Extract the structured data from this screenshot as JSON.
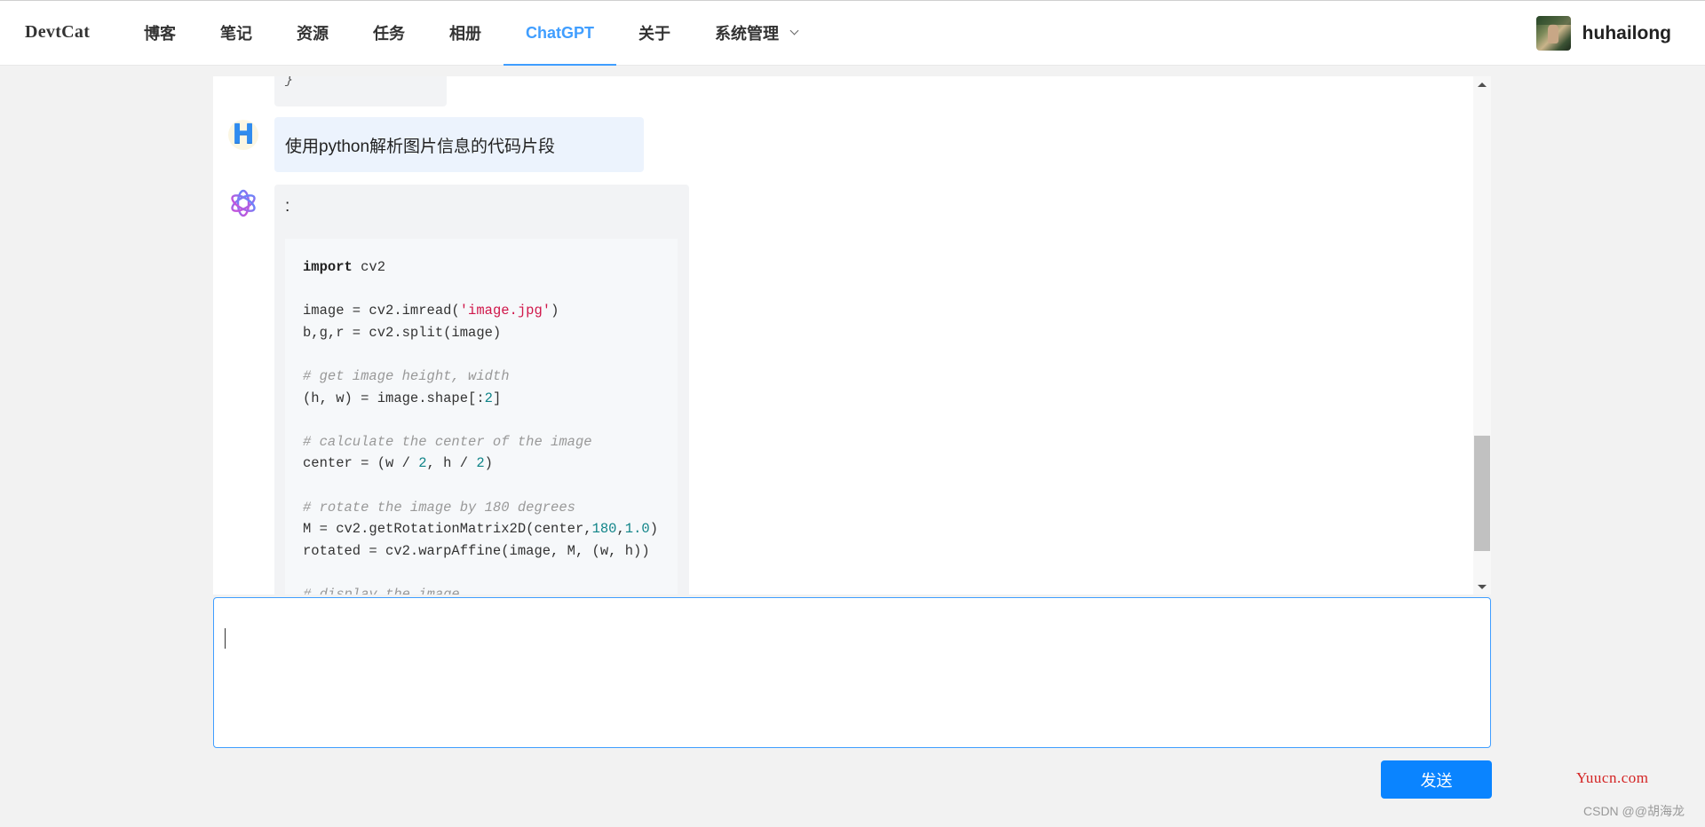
{
  "header": {
    "brand": "DevtCat",
    "nav": [
      {
        "label": "博客",
        "active": false
      },
      {
        "label": "笔记",
        "active": false
      },
      {
        "label": "资源",
        "active": false
      },
      {
        "label": "任务",
        "active": false
      },
      {
        "label": "相册",
        "active": false
      },
      {
        "label": "ChatGPT",
        "active": true
      },
      {
        "label": "关于",
        "active": false
      },
      {
        "label": "系统管理",
        "active": false,
        "dropdown": true
      }
    ],
    "user": {
      "name": "huhailong"
    }
  },
  "chat": {
    "previous_tail": "}",
    "user_avatar_letter": "H",
    "user_message": "使用python解析图片信息的代码片段",
    "bot_intro": ":",
    "code_lines": [
      [
        {
          "t": "import",
          "c": "kw"
        },
        {
          "t": " cv2",
          "c": ""
        }
      ],
      [],
      [
        {
          "t": "image = cv2.imread(",
          "c": ""
        },
        {
          "t": "'image.jpg'",
          "c": "str"
        },
        {
          "t": ")",
          "c": ""
        }
      ],
      [
        {
          "t": "b,g,r = cv2.split(image)",
          "c": ""
        }
      ],
      [],
      [
        {
          "t": "# get image height, width",
          "c": "cmt"
        }
      ],
      [
        {
          "t": "(h, w) = image.shape[:",
          "c": ""
        },
        {
          "t": "2",
          "c": "num"
        },
        {
          "t": "]",
          "c": ""
        }
      ],
      [],
      [
        {
          "t": "# calculate the center of the image",
          "c": "cmt"
        }
      ],
      [
        {
          "t": "center = (w / ",
          "c": ""
        },
        {
          "t": "2",
          "c": "num"
        },
        {
          "t": ", h / ",
          "c": ""
        },
        {
          "t": "2",
          "c": "num"
        },
        {
          "t": ")",
          "c": ""
        }
      ],
      [],
      [
        {
          "t": "# rotate the image by 180 degrees",
          "c": "cmt"
        }
      ],
      [
        {
          "t": "M = cv2.getRotationMatrix2D(center,",
          "c": ""
        },
        {
          "t": "180",
          "c": "num"
        },
        {
          "t": ",",
          "c": ""
        },
        {
          "t": "1.0",
          "c": "num"
        },
        {
          "t": ")",
          "c": ""
        }
      ],
      [
        {
          "t": "rotated = cv2.warpAffine(image, M, (w, h))",
          "c": ""
        }
      ],
      [],
      [
        {
          "t": "# display the image",
          "c": "cmt"
        }
      ]
    ]
  },
  "input": {
    "value": "",
    "placeholder": ""
  },
  "send_button": {
    "label": "发送"
  },
  "watermarks": {
    "site": "Yuucn.com",
    "csdn": "CSDN @@胡海龙"
  },
  "colors": {
    "accent": "#409eff",
    "send_button": "#0a84ff",
    "user_bubble": "#ecf3fd",
    "bot_bubble": "#f2f3f5"
  }
}
